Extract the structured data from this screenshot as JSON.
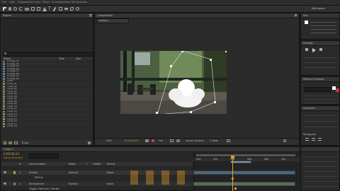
{
  "menubar": {
    "items": [
      "File",
      "Edit",
      "Composition",
      "Layer",
      "Effect",
      "Animation",
      "View",
      "Window",
      "Help"
    ]
  },
  "toolbar": {
    "workspace_label": "Workspace"
  },
  "project_panel": {
    "title": "Project",
    "search_placeholder": "",
    "columns": [
      "Name",
      "Type",
      "Size"
    ],
    "items": [
      "footage_01",
      "footage_02",
      "footage_03",
      "footage_04",
      "footage_05",
      "footage_06",
      "footage_07",
      "footage_08",
      "Solids",
      "comp_01",
      "comp_02",
      "comp_03",
      "comp_04",
      "comp_05",
      "comp_06",
      "comp_07",
      "comp_08",
      "comp_09",
      "comp_10",
      "comp_11",
      "comp_12",
      "comp_13",
      "comp_14",
      "comp_15",
      "comp_16",
      "comp_17",
      "comp_18"
    ],
    "footer_bpc": "8 bpc"
  },
  "composition_panel": {
    "title": "Composition",
    "tab": "Comp 1",
    "zoom": "50%",
    "timecode": "0:00:04:23",
    "resolution": "Full",
    "camera": "Active Camera",
    "view": "1 View"
  },
  "right_panels": {
    "info_title": "Info",
    "preview_title": "Preview",
    "effects_title": "Effects & Presets",
    "character_title": "Character",
    "paragraph_title": "Paragraph"
  },
  "timeline": {
    "title": "Comp 1",
    "timecode": "0:00:04:23",
    "fps": "00119 (25.00 fps)",
    "columns": [
      "#",
      "Source Name",
      "Mode",
      "T",
      "TrkMat",
      "Parent"
    ],
    "layers": [
      {
        "num": "1",
        "name": "Smoke",
        "mode": "Normal",
        "parent": "None"
      },
      {
        "num": "2",
        "name": "Background",
        "mode": "Normal",
        "parent": "None"
      }
    ],
    "layer_sub": "Effects",
    "ruler": [
      "00s",
      "02s",
      "04s",
      "06s",
      "08s",
      "10s"
    ],
    "toggle_label": "Toggle Switches / Modes"
  },
  "colors": {
    "accent": "#e8a02a",
    "clip": "#4f6677",
    "playhead": "#e8a02a",
    "bg": "#2a2a2a"
  }
}
